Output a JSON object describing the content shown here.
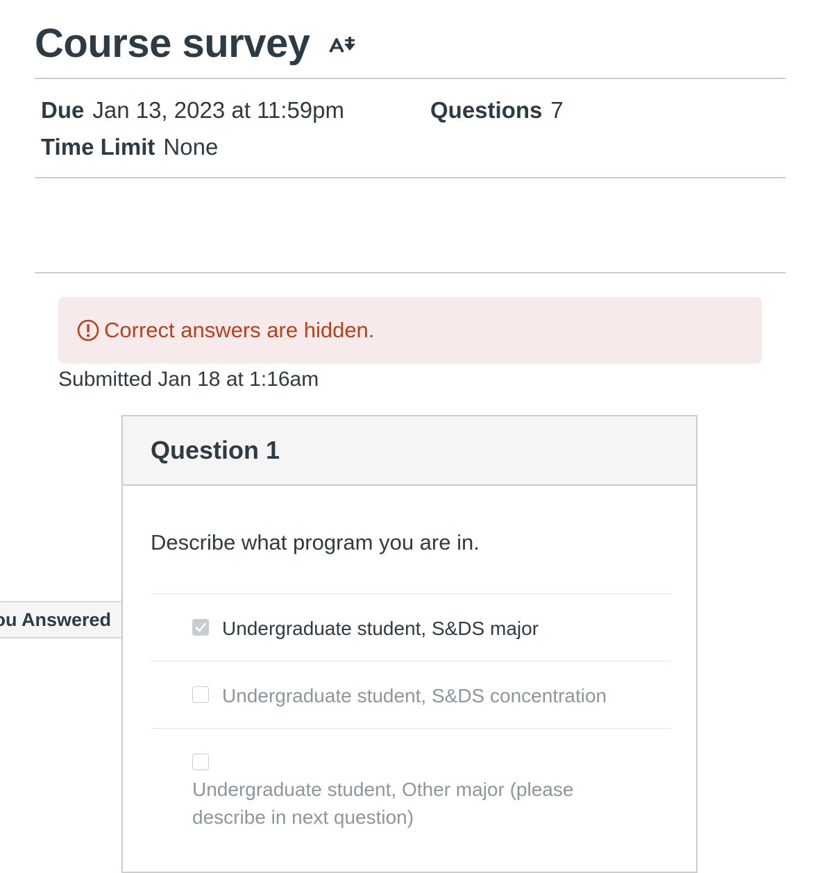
{
  "title": "Course survey",
  "meta": {
    "due_label": "Due",
    "due_value": "Jan 13, 2023 at 11:59pm",
    "questions_label": "Questions",
    "questions_value": "7",
    "time_limit_label": "Time Limit",
    "time_limit_value": "None"
  },
  "alert": {
    "text": "Correct answers are hidden.",
    "icon": "warning-circle-icon",
    "color": "#b8401f",
    "background": "#f7eaea"
  },
  "submitted_text": "Submitted Jan 18 at 1:16am",
  "question": {
    "header": "Question 1",
    "text": "Describe what program you are in.",
    "you_answered_label": "ou Answered",
    "answers": [
      {
        "label": "Undergraduate student, S&DS major",
        "checked": true
      },
      {
        "label": "Undergraduate student, S&DS concentration",
        "checked": false
      },
      {
        "label": "Undergraduate student, Other major (please describe in next question)",
        "checked": false
      }
    ]
  },
  "icons": {
    "immersive_reader": "immersive-reader-icon",
    "checkbox_check": "check-icon"
  }
}
